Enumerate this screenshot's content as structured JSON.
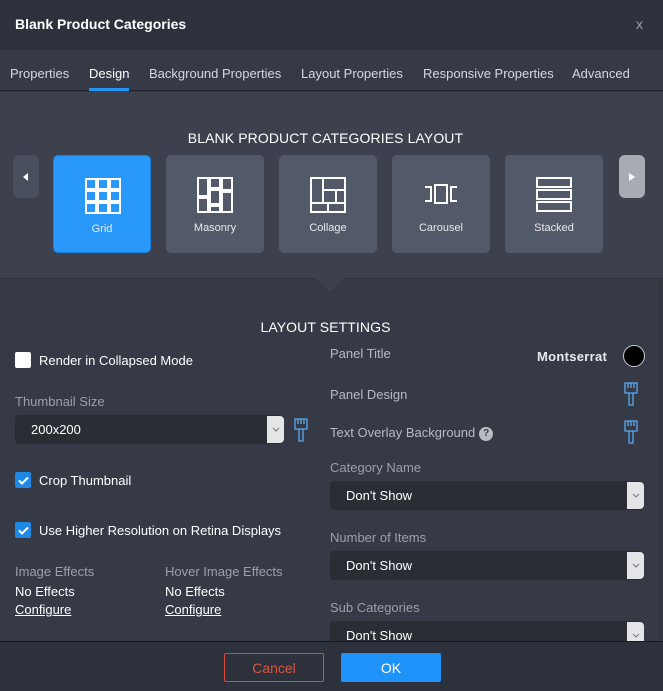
{
  "window": {
    "title": "Blank Product Categories",
    "close_label": "x"
  },
  "tabs": [
    {
      "label": "Properties",
      "active": false
    },
    {
      "label": "Design",
      "active": true
    },
    {
      "label": "Background Properties",
      "active": false
    },
    {
      "label": "Layout Properties",
      "active": false
    },
    {
      "label": "Responsive Properties",
      "active": false
    },
    {
      "label": "Advanced",
      "active": false
    }
  ],
  "layout": {
    "heading": "BLANK PRODUCT CATEGORIES LAYOUT",
    "prev_icon": "triangle-left-icon",
    "next_icon": "triangle-right-icon",
    "options": [
      {
        "label": "Grid",
        "icon": "grid-icon",
        "selected": true
      },
      {
        "label": "Masonry",
        "icon": "masonry-icon",
        "selected": false
      },
      {
        "label": "Collage",
        "icon": "collage-icon",
        "selected": false
      },
      {
        "label": "Carousel",
        "icon": "carousel-icon",
        "selected": false
      },
      {
        "label": "Stacked",
        "icon": "stacked-icon",
        "selected": false
      }
    ]
  },
  "settings": {
    "heading": "LAYOUT SETTINGS",
    "render_collapsed": {
      "label": "Render in Collapsed Mode",
      "checked": false
    },
    "thumbnail_size": {
      "label": "Thumbnail Size",
      "value": "200x200"
    },
    "crop_thumbnail": {
      "label": "Crop Thumbnail",
      "checked": true
    },
    "retina": {
      "label": "Use Higher Resolution on Retina Displays",
      "checked": true
    },
    "image_effects": {
      "label": "Image Effects",
      "value": "No Effects",
      "link": "Configure"
    },
    "hover_effects": {
      "label": "Hover Image Effects",
      "value": "No Effects",
      "link": "Configure"
    },
    "panel_title": {
      "label": "Panel Title",
      "font": "Montserrat",
      "color": "#000000"
    },
    "panel_design": {
      "label": "Panel Design"
    },
    "text_overlay": {
      "label": "Text Overlay Background",
      "help": "?"
    },
    "category_name": {
      "label": "Category Name",
      "value": "Don't Show"
    },
    "number_of_items": {
      "label": "Number of Items",
      "value": "Don't Show"
    },
    "sub_categories": {
      "label": "Sub Categories",
      "value": "Don't Show"
    }
  },
  "footer": {
    "cancel_label": "Cancel",
    "ok_label": "OK"
  },
  "colors": {
    "accent": "#2196f3",
    "selected_card": "#2899fa",
    "cancel": "#e0533f",
    "ok": "#1e93fa",
    "brush_icon": "#5aa9f0"
  }
}
